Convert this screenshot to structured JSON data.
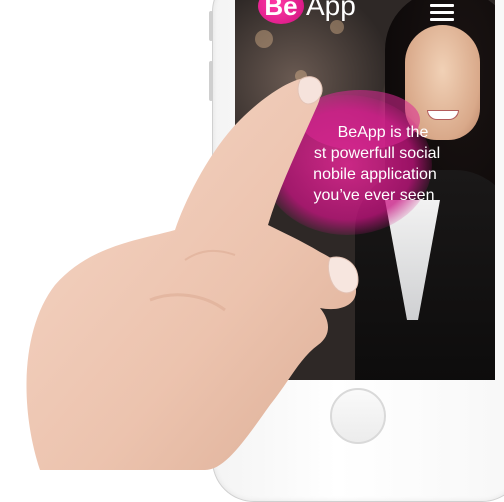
{
  "app": {
    "logo_mark": "Be",
    "logo_word": "App",
    "menu_icon": "hamburger-menu-icon"
  },
  "hero": {
    "tagline_line1": "BeApp is the",
    "tagline_line2": "st powerfull social",
    "tagline_line3": "nobile application",
    "tagline_line4": "you’ve ever seen"
  },
  "colors": {
    "brand_pink": "#e0208f",
    "phone_body": "#f7f7f7",
    "screen_bg": "#2a2626"
  }
}
